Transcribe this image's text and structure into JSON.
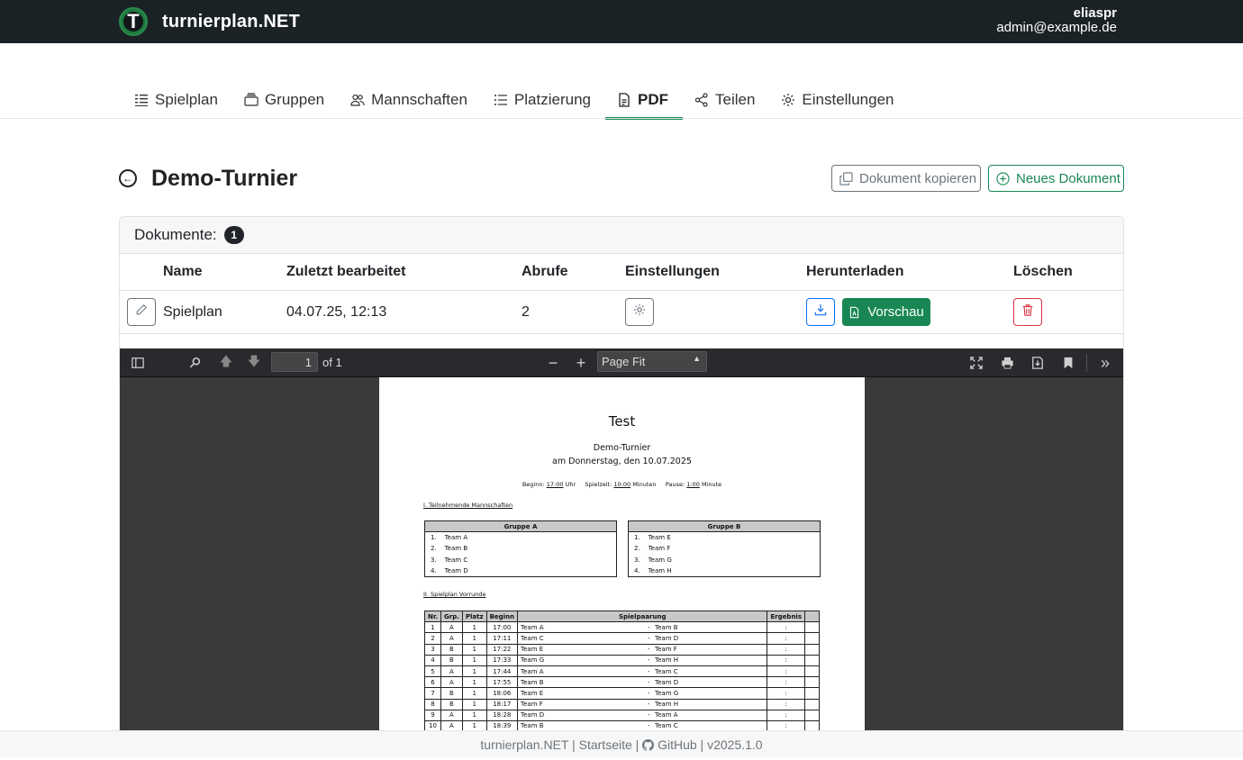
{
  "app": {
    "name": "turnierplan.NET",
    "logo_letter": "T"
  },
  "user": {
    "name": "eliaspr",
    "email": "admin@example.de"
  },
  "tabs": [
    {
      "label": "Spielplan",
      "icon": "list-icon",
      "active": false
    },
    {
      "label": "Gruppen",
      "icon": "groups-icon",
      "active": false
    },
    {
      "label": "Mannschaften",
      "icon": "people-icon",
      "active": false
    },
    {
      "label": "Platzierung",
      "icon": "ranking-icon",
      "active": false
    },
    {
      "label": "PDF",
      "icon": "pdf-icon",
      "active": true
    },
    {
      "label": "Teilen",
      "icon": "share-icon",
      "active": false
    },
    {
      "label": "Einstellungen",
      "icon": "gear-icon",
      "active": false
    }
  ],
  "page": {
    "title": "Demo-Turnier",
    "copy_button": "Dokument kopieren",
    "new_button": "Neues Dokument"
  },
  "documents": {
    "label": "Dokumente:",
    "count": "1",
    "columns": [
      "Name",
      "Zuletzt bearbeitet",
      "Abrufe",
      "Einstellungen",
      "Herunterladen",
      "Löschen"
    ],
    "rows": [
      {
        "name": "Spielplan",
        "edited": "04.07.25, 12:13",
        "views": "2",
        "preview": "Vorschau"
      }
    ]
  },
  "viewer": {
    "page": "1",
    "of": "of 1",
    "zoom": "Page Fit"
  },
  "pdf": {
    "title": "Test",
    "tournament": "Demo-Turnier",
    "date": "am Donnerstag, den 10.07.2025",
    "begin_label": "Beginn:",
    "begin": "17:00",
    "begin_unit": "Uhr",
    "playtime_label": "Spielzeit:",
    "playtime": "10:00",
    "playtime_unit": "Minuten",
    "pause_label": "Pause:",
    "pause": "1:00",
    "pause_unit": "Minute",
    "section1": "I. Teilnehmende Mannschaften",
    "groups": [
      {
        "name": "Gruppe A",
        "teams": [
          "Team A",
          "Team B",
          "Team C",
          "Team D"
        ]
      },
      {
        "name": "Gruppe B",
        "teams": [
          "Team E",
          "Team F",
          "Team G",
          "Team H"
        ]
      }
    ],
    "section2": "II. Spielplan Vorrunde",
    "schedule_headers": [
      "Nr.",
      "Grp.",
      "Platz",
      "Beginn",
      "Spielpaarung",
      "Ergebnis"
    ],
    "schedule": [
      [
        "1",
        "A",
        "1",
        "17:00",
        "Team A",
        "Team B"
      ],
      [
        "2",
        "A",
        "1",
        "17:11",
        "Team C",
        "Team D"
      ],
      [
        "3",
        "B",
        "1",
        "17:22",
        "Team E",
        "Team F"
      ],
      [
        "4",
        "B",
        "1",
        "17:33",
        "Team G",
        "Team H"
      ],
      [
        "5",
        "A",
        "1",
        "17:44",
        "Team A",
        "Team C"
      ],
      [
        "6",
        "A",
        "1",
        "17:55",
        "Team B",
        "Team D"
      ],
      [
        "7",
        "B",
        "1",
        "18:06",
        "Team E",
        "Team G"
      ],
      [
        "8",
        "B",
        "1",
        "18:17",
        "Team F",
        "Team H"
      ],
      [
        "9",
        "A",
        "1",
        "18:28",
        "Team D",
        "Team A"
      ],
      [
        "10",
        "A",
        "1",
        "18:39",
        "Team B",
        "Team C"
      ]
    ]
  },
  "footer": {
    "app": "turnierplan.NET",
    "home": "Startseite",
    "github": "GitHub",
    "version": "v2025.1.0"
  },
  "colors": {
    "accent": "#198754",
    "topbar": "#1b2226",
    "danger": "#dc3545",
    "primary": "#0d6efd"
  }
}
